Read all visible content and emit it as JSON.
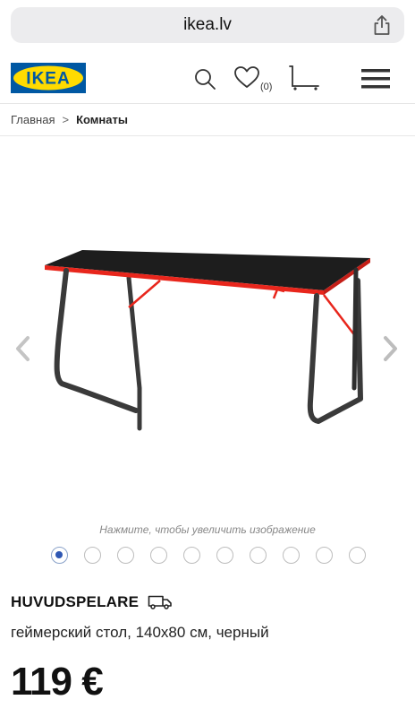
{
  "browser": {
    "url": "ikea.lv"
  },
  "header": {
    "logo_text": "IKEA",
    "wishlist_count": "(0)"
  },
  "breadcrumb": {
    "home": "Главная",
    "separator": ">",
    "current": "Комнаты"
  },
  "gallery": {
    "hint": "Нажмите, чтобы увеличить изображение",
    "total_images": 10,
    "active_index": 0
  },
  "product": {
    "name": "HUVUDSPELARE",
    "description": "геймерский стол, 140x80 см, черный",
    "price": "119 €"
  },
  "colors": {
    "ikea_blue": "#0058a3",
    "ikea_yellow": "#ffdb00",
    "accent_red": "#e8261c",
    "dot_active": "#2f57b3"
  }
}
